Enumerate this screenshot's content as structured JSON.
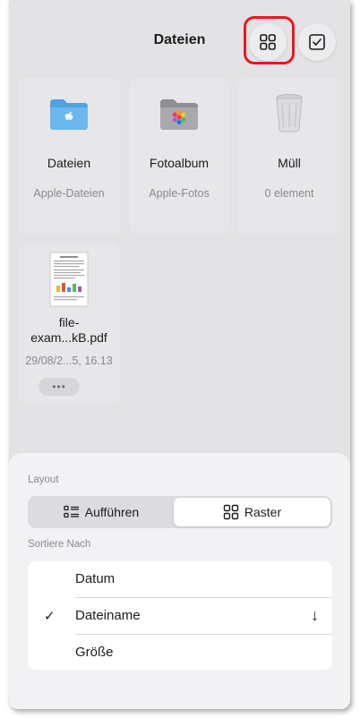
{
  "header": {
    "title": "Dateien",
    "grid_button_icon": "grid-icon",
    "select_button_icon": "checkbox-icon"
  },
  "tiles": [
    {
      "name": "Dateien",
      "subtitle": "Apple-Dateien",
      "icon": "folder-icon"
    },
    {
      "name": "Fotoalbum",
      "subtitle": "Apple-Fotos",
      "icon": "photo-album-icon"
    },
    {
      "name": "Müll",
      "subtitle": "0 element",
      "icon": "trash-icon"
    }
  ],
  "file": {
    "name_line1": "file-",
    "name_line2": "exam...kB.pdf",
    "date": "29/08/2...5, 16.13",
    "more_label": "•••"
  },
  "sheet": {
    "layout_label": "Layout",
    "layout_options": [
      "Aufführen",
      "Raster"
    ],
    "layout_selected": "Raster",
    "sort_label": "Sortiere Nach",
    "sort_options": [
      {
        "label": "Datum",
        "checked": false
      },
      {
        "label": "Dateiname",
        "checked": true,
        "direction": "descending"
      },
      {
        "label": "Größe",
        "checked": false
      }
    ],
    "check_glyph": "✓",
    "arrow_glyph": "↓"
  },
  "colors": {
    "folder_blue": "#5fb0e8",
    "highlight_red": "#f0141e",
    "background": "#e3e3e5"
  }
}
